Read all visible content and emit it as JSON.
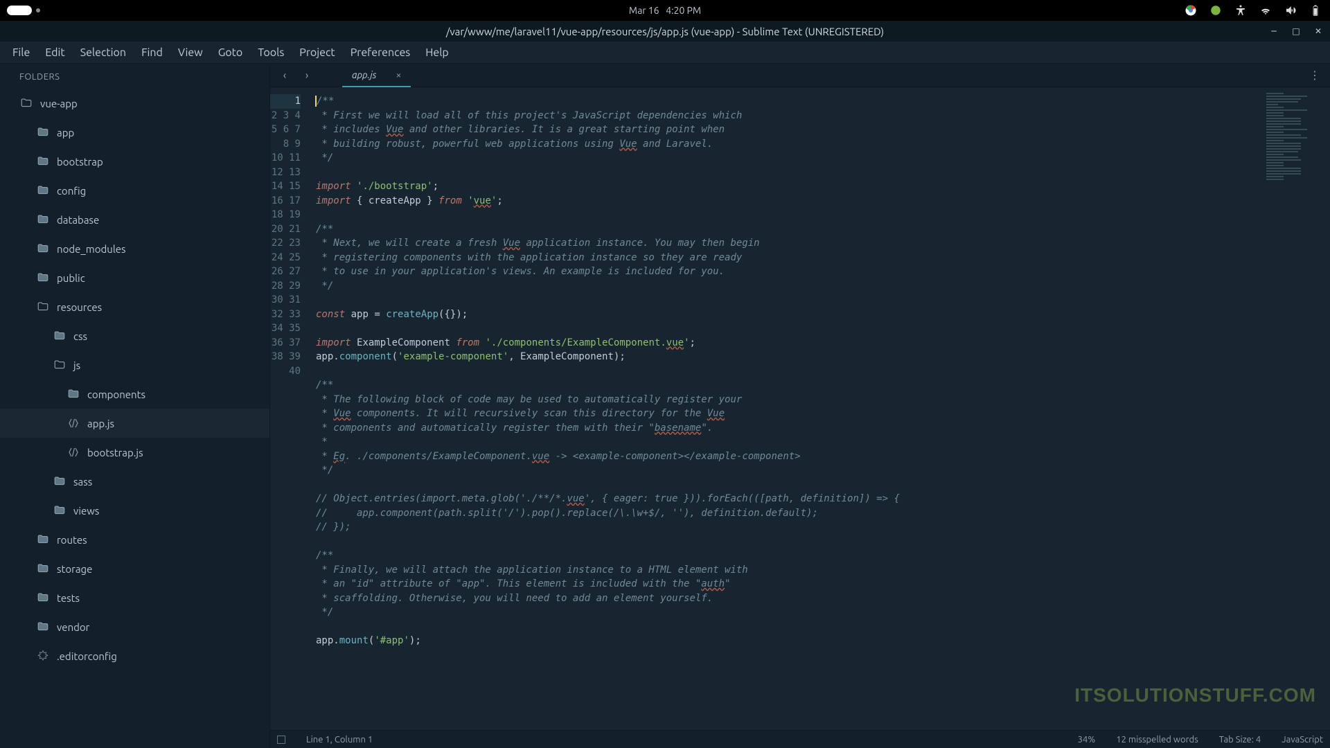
{
  "topbar": {
    "date": "Mar 16",
    "time": "4:20 PM"
  },
  "window": {
    "title": "/var/www/me/laravel11/vue-app/resources/js/app.js (vue-app) - Sublime Text (UNREGISTERED)"
  },
  "menubar": [
    "File",
    "Edit",
    "Selection",
    "Find",
    "View",
    "Goto",
    "Tools",
    "Project",
    "Preferences",
    "Help"
  ],
  "sidebar": {
    "header": "FOLDERS",
    "tree": [
      {
        "label": "vue-app",
        "depth": 0,
        "type": "folder-open"
      },
      {
        "label": "app",
        "depth": 1,
        "type": "folder"
      },
      {
        "label": "bootstrap",
        "depth": 1,
        "type": "folder"
      },
      {
        "label": "config",
        "depth": 1,
        "type": "folder"
      },
      {
        "label": "database",
        "depth": 1,
        "type": "folder"
      },
      {
        "label": "node_modules",
        "depth": 1,
        "type": "folder"
      },
      {
        "label": "public",
        "depth": 1,
        "type": "folder"
      },
      {
        "label": "resources",
        "depth": 1,
        "type": "folder-open"
      },
      {
        "label": "css",
        "depth": 2,
        "type": "folder"
      },
      {
        "label": "js",
        "depth": 2,
        "type": "folder-open"
      },
      {
        "label": "components",
        "depth": 3,
        "type": "folder"
      },
      {
        "label": "app.js",
        "depth": 3,
        "type": "js",
        "active": true
      },
      {
        "label": "bootstrap.js",
        "depth": 3,
        "type": "js"
      },
      {
        "label": "sass",
        "depth": 2,
        "type": "folder"
      },
      {
        "label": "views",
        "depth": 2,
        "type": "folder"
      },
      {
        "label": "routes",
        "depth": 1,
        "type": "folder"
      },
      {
        "label": "storage",
        "depth": 1,
        "type": "folder"
      },
      {
        "label": "tests",
        "depth": 1,
        "type": "folder"
      },
      {
        "label": "vendor",
        "depth": 1,
        "type": "folder"
      },
      {
        "label": ".editorconfig",
        "depth": 1,
        "type": "file-settings"
      }
    ]
  },
  "tab": {
    "label": "app.js"
  },
  "code": {
    "lines": [
      [
        [
          "comment",
          "/**"
        ]
      ],
      [
        [
          "comment",
          " * First we will load all of this project's JavaScript dependencies which"
        ]
      ],
      [
        [
          "comment",
          " * includes "
        ],
        [
          "comment spelled",
          "Vue"
        ],
        [
          "comment",
          " and other libraries. It is a great starting point when"
        ]
      ],
      [
        [
          "comment",
          " * building robust, powerful web applications using "
        ],
        [
          "comment spelled",
          "Vue"
        ],
        [
          "comment",
          " and Laravel."
        ]
      ],
      [
        [
          "comment",
          " */"
        ]
      ],
      [],
      [
        [
          "kw",
          "import"
        ],
        [
          "punc",
          " "
        ],
        [
          "str",
          "'./bootstrap'"
        ],
        [
          "punc",
          ";"
        ]
      ],
      [
        [
          "kw",
          "import"
        ],
        [
          "punc",
          " { "
        ],
        [
          "name",
          "createApp"
        ],
        [
          "punc",
          " } "
        ],
        [
          "kw",
          "from"
        ],
        [
          "punc",
          " "
        ],
        [
          "str",
          "'"
        ],
        [
          "str spelled",
          "vue"
        ],
        [
          "str",
          "'"
        ],
        [
          "punc",
          ";"
        ]
      ],
      [],
      [
        [
          "comment",
          "/**"
        ]
      ],
      [
        [
          "comment",
          " * Next, we will create a fresh "
        ],
        [
          "comment spelled",
          "Vue"
        ],
        [
          "comment",
          " application instance. You may then begin"
        ]
      ],
      [
        [
          "comment",
          " * registering components with the application instance so they are ready"
        ]
      ],
      [
        [
          "comment",
          " * to use in your application's views. An example is included for you."
        ]
      ],
      [
        [
          "comment",
          " */"
        ]
      ],
      [],
      [
        [
          "const",
          "const"
        ],
        [
          "punc",
          " "
        ],
        [
          "name",
          "app"
        ],
        [
          "punc",
          " = "
        ],
        [
          "fn",
          "createApp"
        ],
        [
          "punc",
          "({});"
        ]
      ],
      [],
      [
        [
          "kw",
          "import"
        ],
        [
          "punc",
          " "
        ],
        [
          "name",
          "ExampleComponent"
        ],
        [
          "punc",
          " "
        ],
        [
          "kw",
          "from"
        ],
        [
          "punc",
          " "
        ],
        [
          "str",
          "'./components/ExampleComponent."
        ],
        [
          "str spelled",
          "vue"
        ],
        [
          "str",
          "'"
        ],
        [
          "punc",
          ";"
        ]
      ],
      [
        [
          "name",
          "app"
        ],
        [
          "punc",
          "."
        ],
        [
          "fn",
          "component"
        ],
        [
          "punc",
          "("
        ],
        [
          "str",
          "'example-component'"
        ],
        [
          "punc",
          ", ExampleComponent);"
        ]
      ],
      [],
      [
        [
          "comment",
          "/**"
        ]
      ],
      [
        [
          "comment",
          " * The following block of code may be used to automatically register your"
        ]
      ],
      [
        [
          "comment",
          " * "
        ],
        [
          "comment spelled",
          "Vue"
        ],
        [
          "comment",
          " components. It will recursively scan this directory for the "
        ],
        [
          "comment spelled",
          "Vue"
        ]
      ],
      [
        [
          "comment",
          " * components and automatically register them with their \""
        ],
        [
          "comment spelled",
          "basename"
        ],
        [
          "comment",
          "\"."
        ]
      ],
      [
        [
          "comment",
          " *"
        ]
      ],
      [
        [
          "comment",
          " * "
        ],
        [
          "comment spelled",
          "Eg"
        ],
        [
          "comment",
          ". ./components/ExampleComponent."
        ],
        [
          "comment spelled",
          "vue"
        ],
        [
          "comment",
          " -> <example-component></example-component>"
        ]
      ],
      [
        [
          "comment",
          " */"
        ]
      ],
      [],
      [
        [
          "comment",
          "// Object.entries(import.meta.glob('./**/*."
        ],
        [
          "comment spelled",
          "vue"
        ],
        [
          "comment",
          "', { eager: true })).forEach(([path, definition]) => {"
        ]
      ],
      [
        [
          "comment",
          "//     app.component(path.split('/').pop().replace(/\\.\\w+$/, ''), definition.default);"
        ]
      ],
      [
        [
          "comment",
          "// });"
        ]
      ],
      [],
      [
        [
          "comment",
          "/**"
        ]
      ],
      [
        [
          "comment",
          " * Finally, we will attach the application instance to a HTML element with"
        ]
      ],
      [
        [
          "comment",
          " * an \"id\" attribute of \"app\". This element is included with the \""
        ],
        [
          "comment spelled",
          "auth"
        ],
        [
          "comment",
          "\""
        ]
      ],
      [
        [
          "comment",
          " * scaffolding. Otherwise, you will need to add an element yourself."
        ]
      ],
      [
        [
          "comment",
          " */"
        ]
      ],
      [],
      [
        [
          "name",
          "app"
        ],
        [
          "punc",
          "."
        ],
        [
          "fn",
          "mount"
        ],
        [
          "punc",
          "("
        ],
        [
          "str",
          "'#app'"
        ],
        [
          "punc",
          ");"
        ]
      ],
      []
    ],
    "current_line": 1
  },
  "statusbar": {
    "position": "Line 1, Column 1",
    "zoom": "34%",
    "spell": "12 misspelled words",
    "tab": "Tab Size: 4",
    "syntax": "JavaScript"
  },
  "watermark": "ITSOLUTIONSTUFF.COM"
}
